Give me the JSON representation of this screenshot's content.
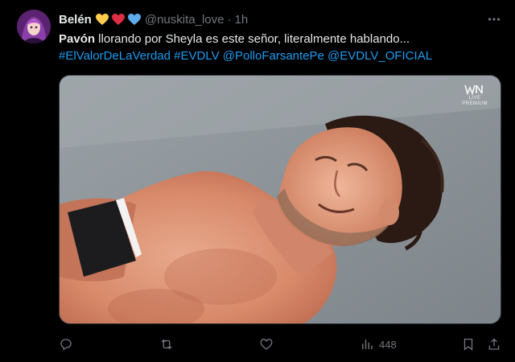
{
  "tweet": {
    "display_name": "Belén",
    "name_emoji": [
      "yellow-heart-icon",
      "red-heart-icon",
      "blue-heart-icon"
    ],
    "handle": "@nuskita_love",
    "separator": "·",
    "time": "1h",
    "text_bold": "Pavón",
    "text_rest": " llorando por Sheyla es este señor, literalmente hablando...",
    "hashtags": [
      "#ElValorDeLaVerdad",
      "#EVDLV",
      "@PolloFarsantePe",
      "@EVDLV_OFICIAL"
    ],
    "media_watermark": "LIVE",
    "media_watermark_sub": "PREMIUM"
  },
  "actions": {
    "views_count": "448"
  },
  "colors": {
    "background": "#000000",
    "text": "#e7e9ea",
    "muted": "#71767b",
    "link": "#1d9bf0",
    "heart_yellow": "#ffcc4d",
    "heart_red": "#dd2e44",
    "heart_blue": "#5dadec"
  }
}
